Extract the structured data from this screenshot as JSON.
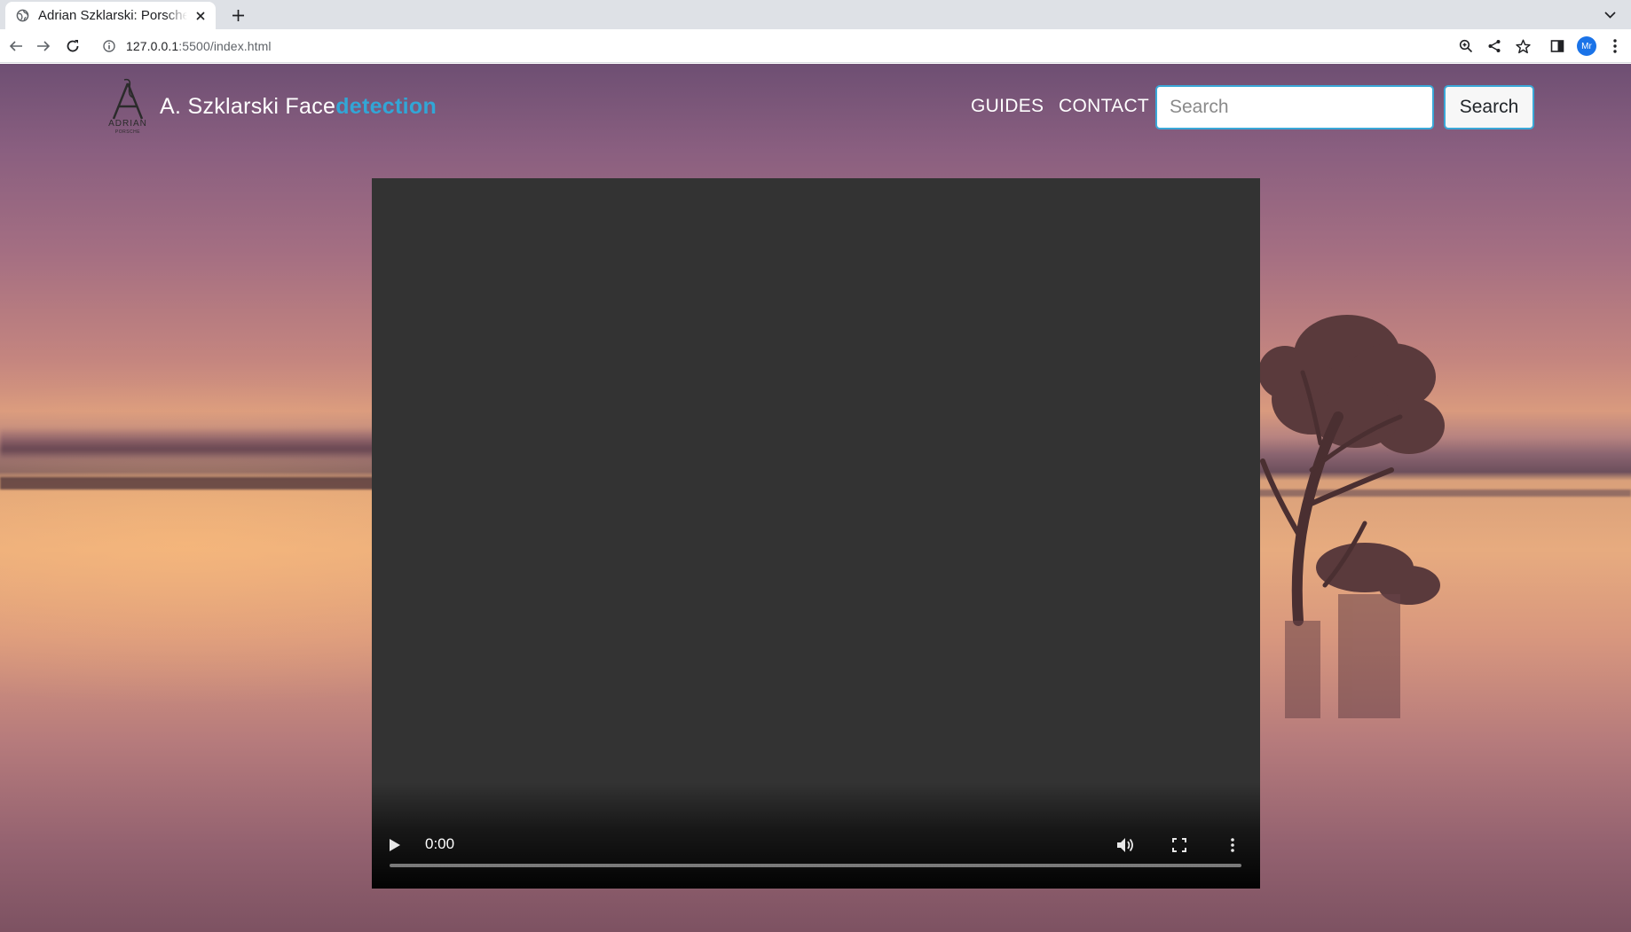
{
  "browser": {
    "tab_title": "Adrian Szklarski: Porsche",
    "url_host": "127.0.0.1",
    "url_rest": ":5500/index.html",
    "profile_initials": "Mr"
  },
  "site": {
    "brand_logo_text": "ADRIAN PORSCHE",
    "brand_name": "A. Szklarski Face",
    "brand_accent": "detection",
    "brand_accent_color": "#32a6d6",
    "nav": {
      "guides": "GUIDES",
      "contact": "CONTACT"
    },
    "search": {
      "placeholder": "Search",
      "value": "",
      "button_label": "Search"
    }
  },
  "video": {
    "current_time": "0:00",
    "progress": 0
  }
}
